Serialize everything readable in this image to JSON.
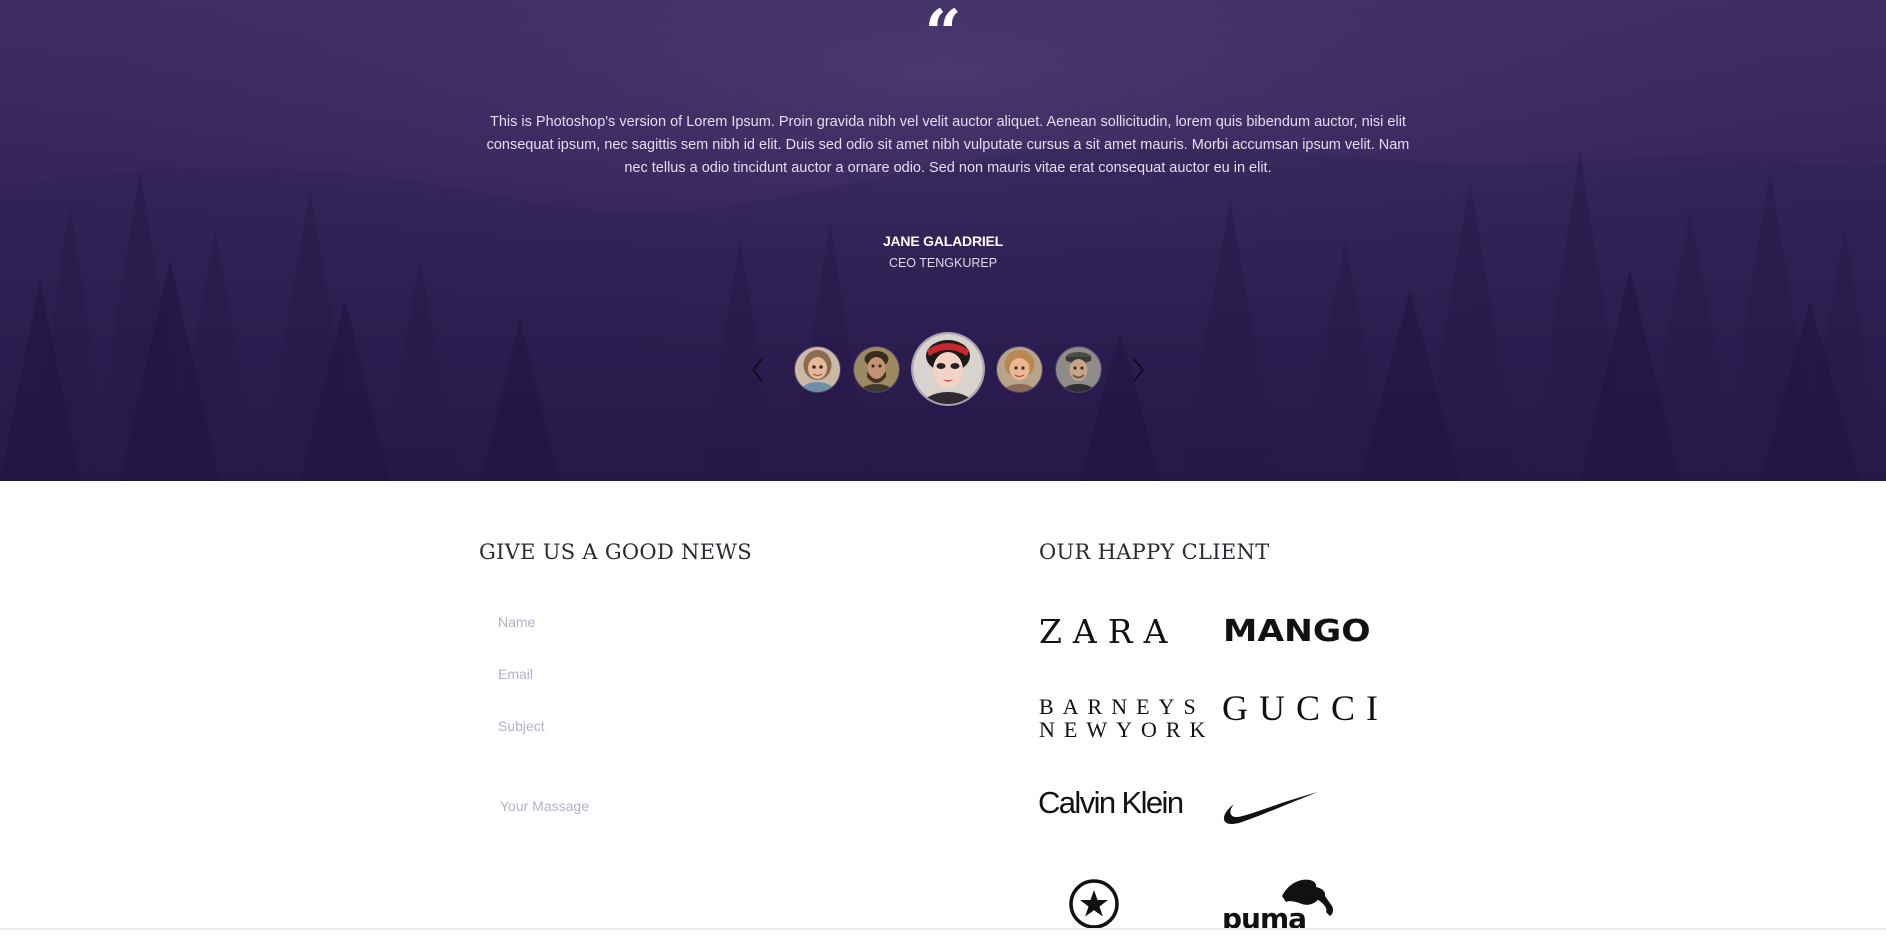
{
  "testimonial": {
    "quote_mark": "“",
    "text": "This is Photoshop's version of Lorem Ipsum. Proin gravida nibh vel velit auctor aliquet. Aenean sollicitudin, lorem quis bibendum auctor, nisi elit consequat ipsum, nec sagittis sem nibh id elit. Duis sed odio sit amet nibh vulputate cursus a sit amet mauris. Morbi accumsan ipsum velit. Nam nec tellus a odio tincidunt auctor a ornare odio. Sed non mauris vitae erat consequat auctor eu in elit.",
    "name": "JANE GALADRIEL",
    "role": "CEO TENGKUREP",
    "selected_avatar": 3,
    "avatar_count": 5
  },
  "contact": {
    "heading": "GIVE US A GOOD NEWS",
    "name_placeholder": "Name",
    "email_placeholder": "Email",
    "subject_placeholder": "Subject",
    "message_placeholder": "Your Massage"
  },
  "clients": {
    "heading": "OUR HAPPY CLIENT",
    "zara": "ZARA",
    "mango": "MANGO",
    "barneys_line1": "BARNEYS",
    "barneys_line2": "NEWYORK",
    "gucci": "GUCCI",
    "calvin_klein": "Calvin Klein",
    "puma": "puma"
  },
  "colors": {
    "hero_top": "#3d2d62",
    "hero_bottom": "#231544",
    "heading": "#2b2b33",
    "placeholder": "#b4b0c6"
  }
}
